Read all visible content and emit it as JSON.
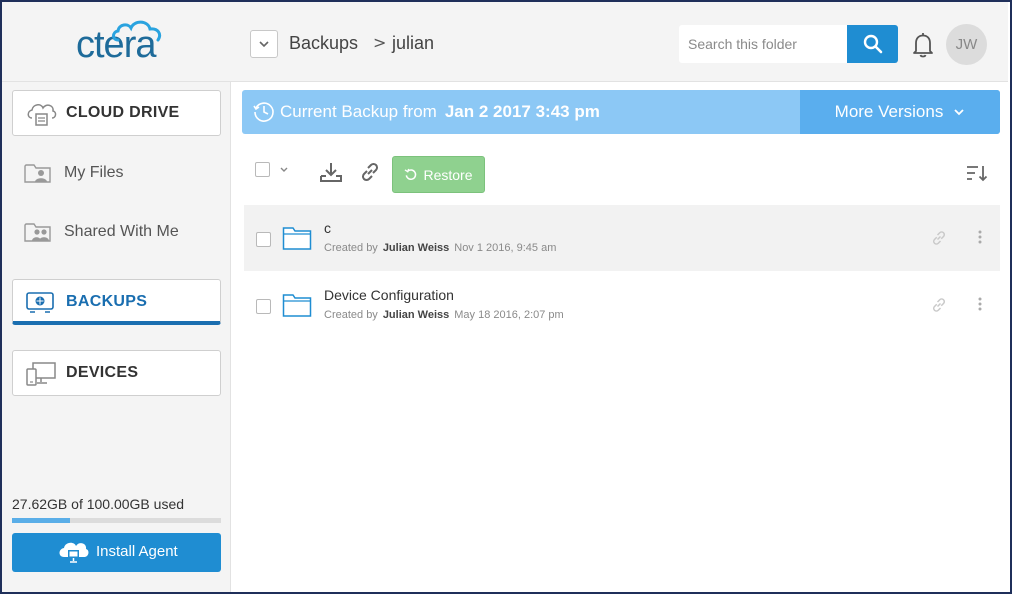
{
  "header": {
    "logo": "ctera",
    "breadcrumb": [
      "Backups",
      "julian"
    ],
    "breadcrumb_separator": ">",
    "search_placeholder": "Search this folder",
    "user_initials": "JW"
  },
  "sidebar": {
    "cloud_drive": "CLOUD DRIVE",
    "my_files": "My Files",
    "shared_with_me": "Shared With Me",
    "backups": "BACKUPS",
    "devices": "DEVICES",
    "usage_text": "27.62GB of 100.00GB used",
    "usage_fraction": 0.2762,
    "install_agent": "Install Agent"
  },
  "banner": {
    "prefix": "Current Backup from",
    "date": "Jan 2 2017 3:43 pm",
    "more_versions": "More Versions"
  },
  "toolbar": {
    "restore": "Restore"
  },
  "files": [
    {
      "name": "c",
      "created_by_label": "Created by",
      "author": "Julian Weiss",
      "date": "Nov 1 2016, 9:45 am"
    },
    {
      "name": "Device Configuration",
      "created_by_label": "Created by",
      "author": "Julian Weiss",
      "date": "May 18 2016, 2:07 pm"
    }
  ],
  "colors": {
    "accent": "#1f8dd2",
    "banner": "#8cc8f5",
    "banner_button": "#5aaeee",
    "restore": "#8fd18f",
    "logo": "#1e6b9a"
  }
}
